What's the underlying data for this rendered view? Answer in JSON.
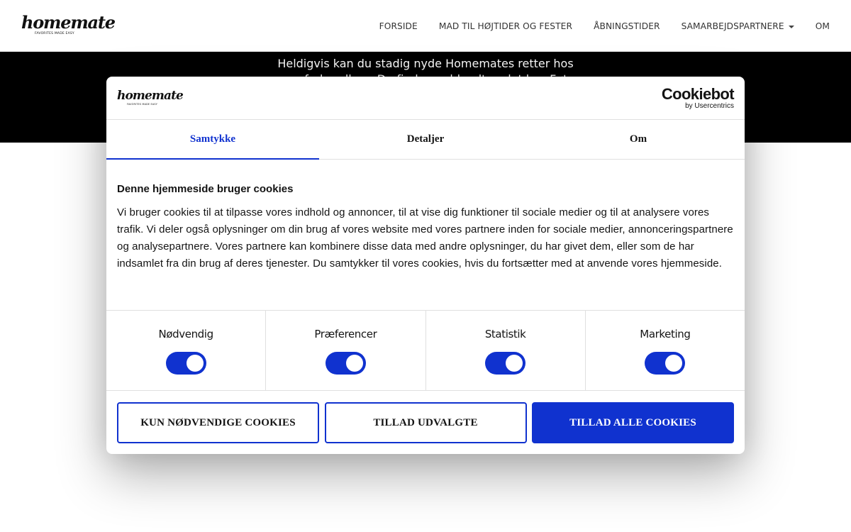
{
  "site": {
    "logo_word": "homemate",
    "logo_tagline": "FAVORITES MADE EASY",
    "nav": [
      {
        "label": "FORSIDE"
      },
      {
        "label": "MAD TIL HØJTIDER OG FESTER"
      },
      {
        "label": "ÅBNINGSTIDER"
      },
      {
        "label": "SAMARBEJDSPARTNERE"
      },
      {
        "label": "OM"
      }
    ]
  },
  "hero": {
    "line1": "Heldigvis kan du stadig nyde Homemates retter hos",
    "line2": "vores forhandlere. Du finder os blandt andet hos Føtex"
  },
  "cookie_dialog": {
    "logo_word": "homemate",
    "logo_tagline": "FAVORITES MADE EASY",
    "brand_name": "Cookiebot",
    "brand_by": "by Usercentrics",
    "tabs": [
      {
        "label": "Samtykke",
        "active": true
      },
      {
        "label": "Detaljer",
        "active": false
      },
      {
        "label": "Om",
        "active": false
      }
    ],
    "title": "Denne hjemmeside bruger cookies",
    "text": "Vi bruger cookies til at tilpasse vores indhold og annoncer, til at vise dig funktioner til sociale medier og til at analysere vores trafik. Vi deler også oplysninger om din brug af vores website med vores partnere inden for sociale medier, annonceringspartnere og analysepartnere. Vores partnere kan kombinere disse data med andre oplysninger, du har givet dem, eller som de har indsamlet fra din brug af deres tjenester. Du samtykker til vores cookies, hvis du fortsætter med at anvende vores hjemmeside.",
    "categories": [
      {
        "label": "Nødvendig",
        "enabled": true
      },
      {
        "label": "Præferencer",
        "enabled": true
      },
      {
        "label": "Statistik",
        "enabled": true
      },
      {
        "label": "Marketing",
        "enabled": true
      }
    ],
    "buttons": {
      "necessary_only": "KUN NØDVENDIGE COOKIES",
      "allow_selected": "TILLAD UDVALGTE",
      "allow_all": "TILLAD ALLE COOKIES"
    },
    "accent_color": "#1032cf"
  }
}
